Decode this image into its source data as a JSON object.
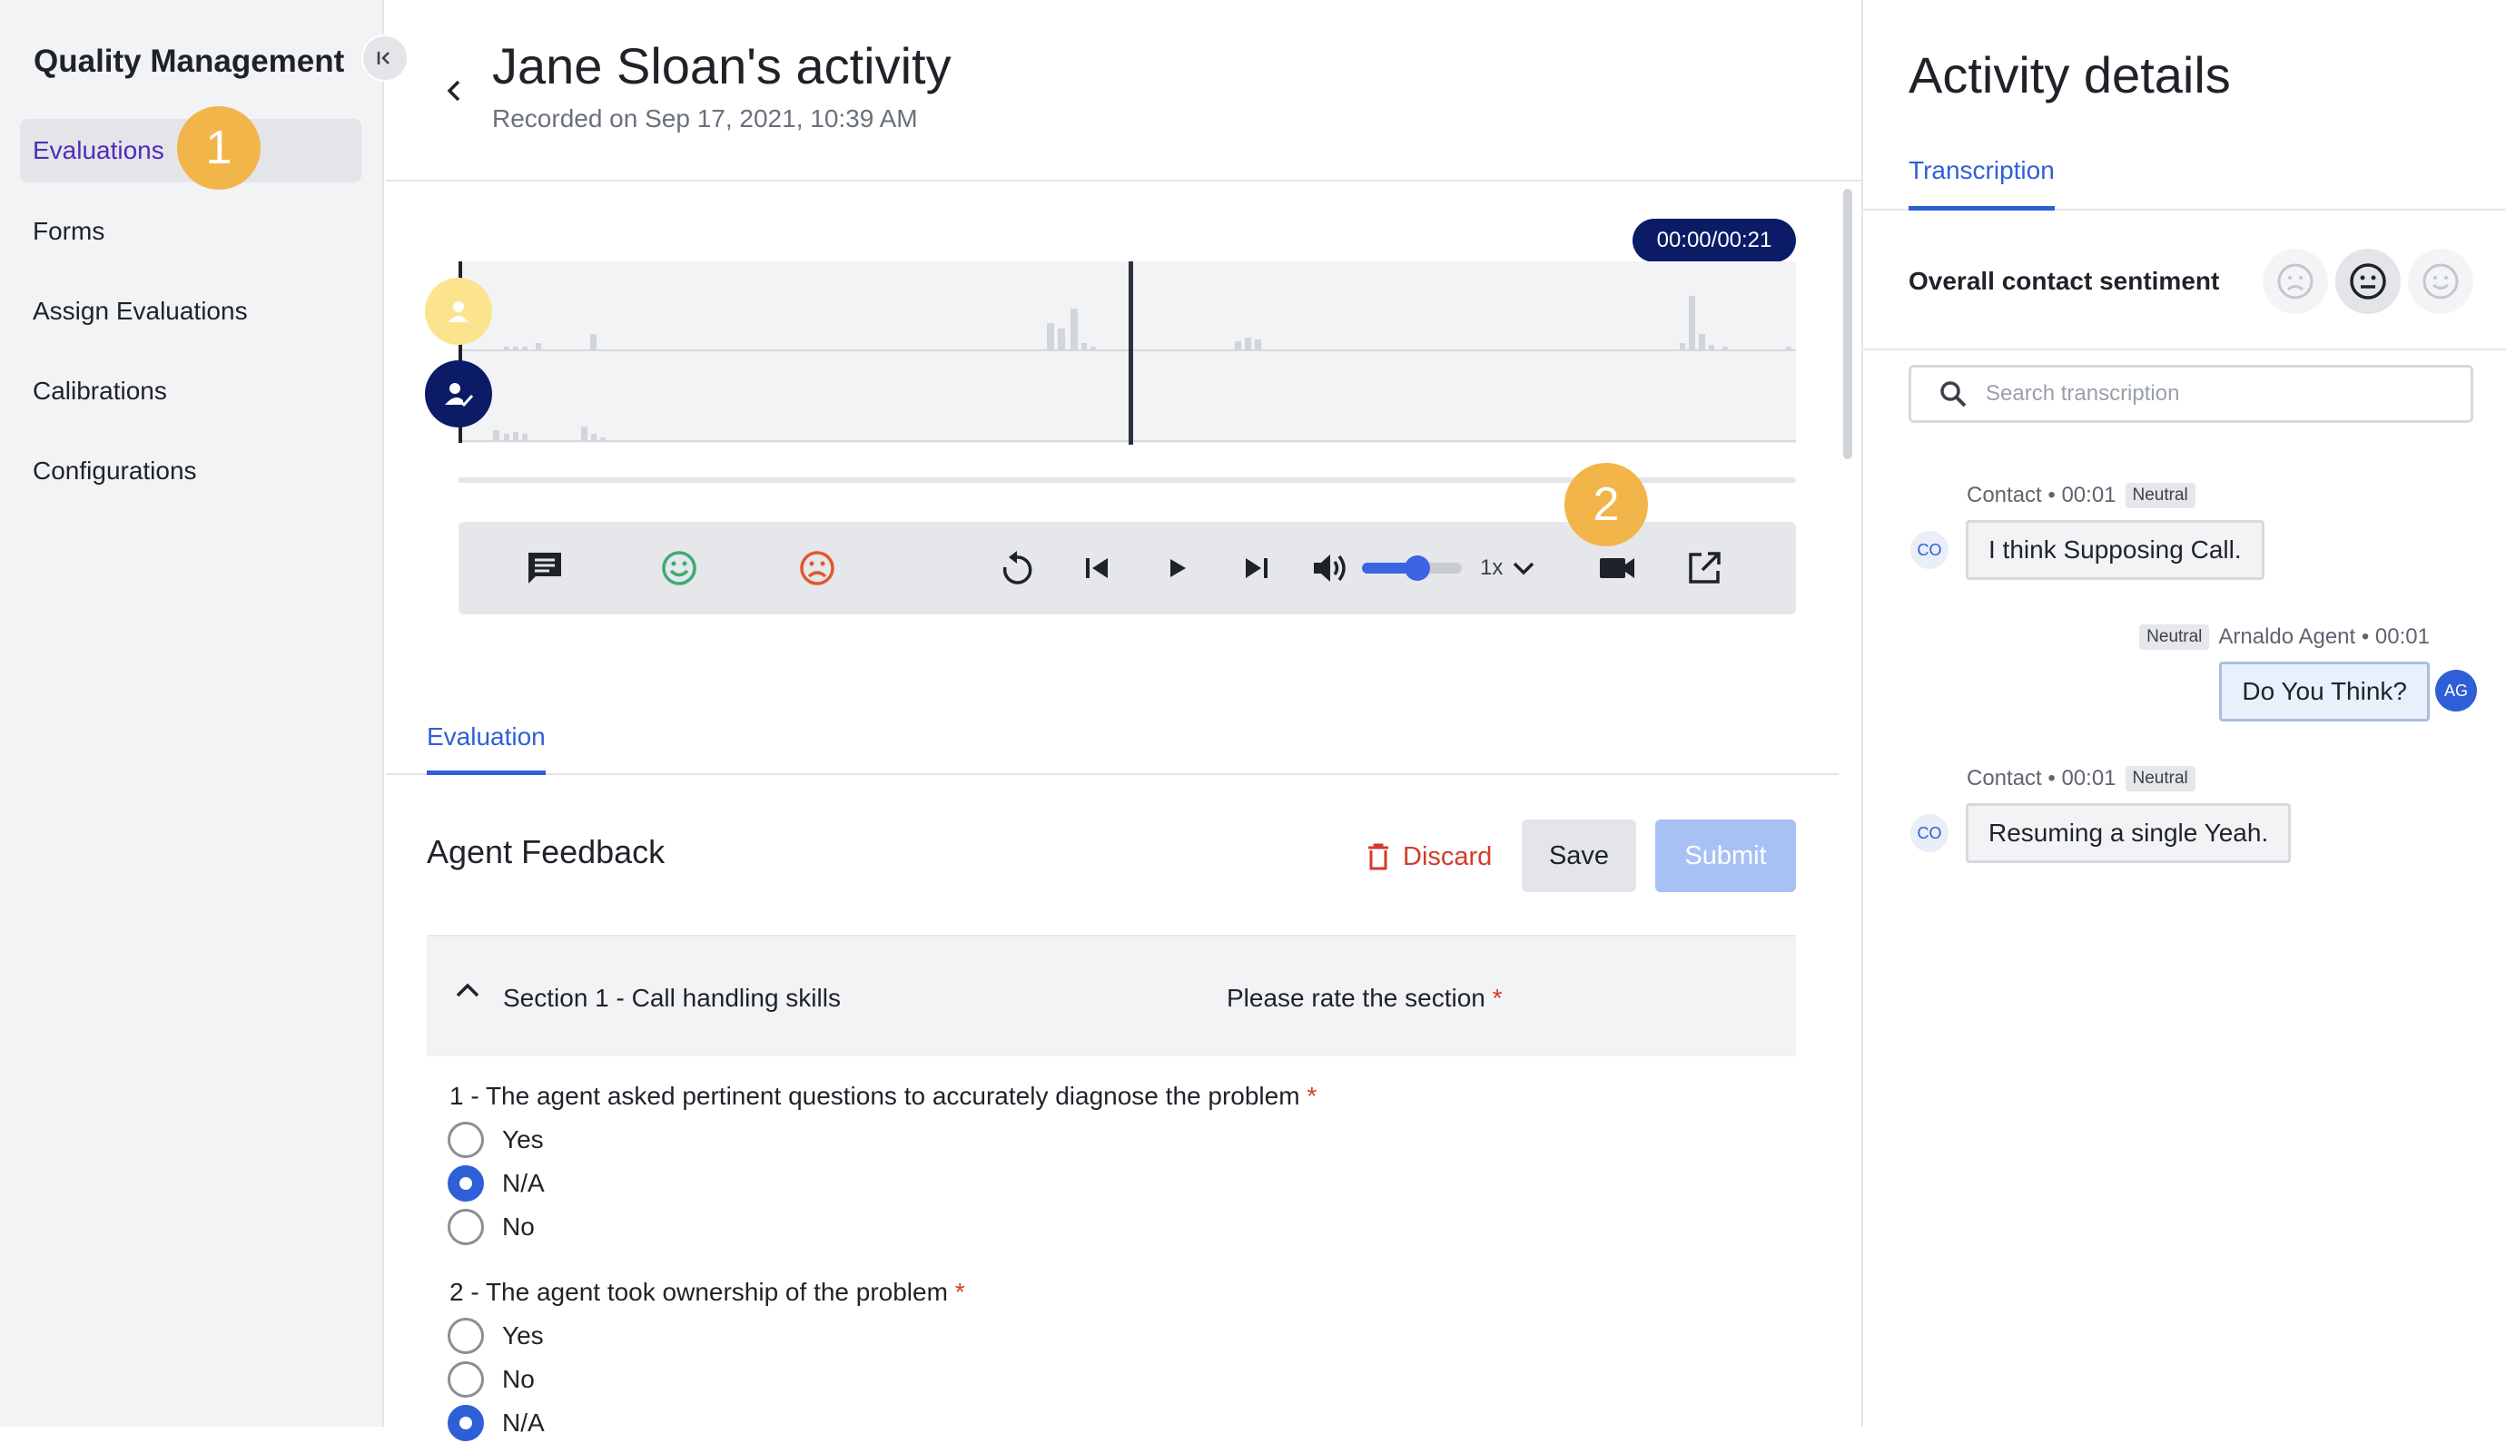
{
  "sidebar": {
    "title": "Quality Management",
    "items": [
      {
        "label": "Evaluations",
        "active": true
      },
      {
        "label": "Forms"
      },
      {
        "label": "Assign Evaluations"
      },
      {
        "label": "Calibrations"
      },
      {
        "label": "Configurations"
      }
    ]
  },
  "callouts": [
    "1",
    "2"
  ],
  "header": {
    "title": "Jane Sloan's activity",
    "recorded": "Recorded on Sep 17, 2021, 10:39 AM"
  },
  "player": {
    "time": "00:00/00:21",
    "speed": "1x",
    "volume_level": 0.55,
    "progress": 0.5,
    "icons": [
      "comment-icon",
      "happy-icon",
      "sad-icon",
      "replay-icon",
      "skip-back-icon",
      "play-icon",
      "skip-forward-icon",
      "volume-icon",
      "chevron-down-icon",
      "video-camera-icon",
      "open-external-icon"
    ]
  },
  "evaluation": {
    "tab": "Evaluation",
    "feedback_title": "Agent Feedback",
    "discard": "Discard",
    "save": "Save",
    "submit": "Submit",
    "section": {
      "title": "Section 1 - Call handling skills",
      "rate_label": "Please rate the section",
      "required_mark": "*",
      "selected_rating": "neutral"
    },
    "questions": [
      {
        "text": "1 - The agent asked pertinent questions to accurately diagnose the problem",
        "required": "*",
        "options": [
          {
            "label": "Yes",
            "checked": false
          },
          {
            "label": "N/A",
            "checked": true
          },
          {
            "label": "No",
            "checked": false
          }
        ]
      },
      {
        "text": "2 - The agent took ownership of the problem",
        "required": "*",
        "options": [
          {
            "label": "Yes",
            "checked": false
          },
          {
            "label": "No",
            "checked": false
          },
          {
            "label": "N/A",
            "checked": true
          }
        ]
      }
    ]
  },
  "details": {
    "title": "Activity details",
    "tab": "Transcription",
    "sentiment_label": "Overall contact sentiment",
    "selected_sentiment": "neutral",
    "search_placeholder": "Search transcription",
    "messages": [
      {
        "meta": "Contact • 00:01",
        "badge": "Neutral",
        "text": "I think Supposing Call.",
        "avatar": "CO",
        "side": "contact"
      },
      {
        "meta": "Arnaldo Agent • 00:01",
        "badge": "Neutral",
        "text": "Do You Think?",
        "avatar": "AG",
        "side": "agent"
      },
      {
        "meta": "Contact • 00:01",
        "badge": "Neutral",
        "text": "Resuming a single Yeah.",
        "avatar": "CO",
        "side": "contact"
      }
    ]
  },
  "colors": {
    "accent": "#2f5fd6",
    "nav_active_text": "#4f2bbd",
    "callout": "#f2b54a",
    "timer_bg": "#0b1b66",
    "discard": "#d23b2b",
    "positive": "#3dab74",
    "negative": "#e2572f"
  }
}
